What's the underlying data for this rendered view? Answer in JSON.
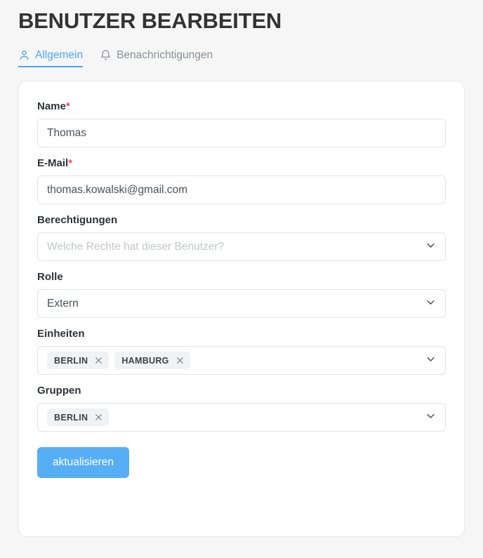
{
  "header": {
    "title": "BENUTZER BEARBEITEN"
  },
  "tabs": [
    {
      "label": "Allgemein",
      "icon": "user-icon",
      "active": true
    },
    {
      "label": "Benachrichtigungen",
      "icon": "bell-icon",
      "active": false
    }
  ],
  "form": {
    "fields": {
      "name": {
        "label": "Name",
        "required_marker": "*",
        "value": "Thomas",
        "placeholder": ""
      },
      "email": {
        "label": "E-Mail",
        "required_marker": "*",
        "value": "thomas.kowalski@gmail.com",
        "placeholder": ""
      },
      "permissions": {
        "label": "Berechtigungen",
        "value": "",
        "placeholder": "Welche Rechte hat dieser Benutzer?"
      },
      "role": {
        "label": "Rolle",
        "value": "Extern",
        "placeholder": ""
      },
      "units": {
        "label": "Einheiten",
        "chips": [
          "BERLIN",
          "HAMBURG"
        ],
        "remove_icon": "close-icon"
      },
      "groups": {
        "label": "Gruppen",
        "chips": [
          "BERLIN"
        ],
        "remove_icon": "close-icon"
      }
    },
    "submit_label": "aktualisieren"
  },
  "colors": {
    "accent": "#4aa8f5",
    "button": "#56aef5",
    "required": "#f2455f",
    "page_bg": "#f6f6f7",
    "card_bg": "#ffffff",
    "chip_bg": "#f1f2f3"
  }
}
